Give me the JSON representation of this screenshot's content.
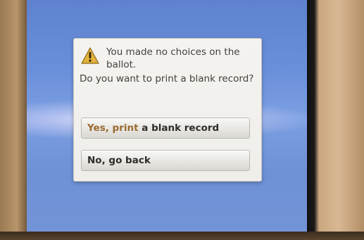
{
  "dialog": {
    "message_line1": "You made no choices on the ballot.",
    "message_line2": "Do you want to print a blank record?",
    "icon": "warning-icon"
  },
  "buttons": {
    "yes_part1": "Yes, print",
    "yes_part2": " a blank record",
    "no_label": "No, go back"
  },
  "colors": {
    "screen_blue": "#6a8fda",
    "dialog_bg": "#f0efeb",
    "warning_yellow": "#e2b23a"
  }
}
